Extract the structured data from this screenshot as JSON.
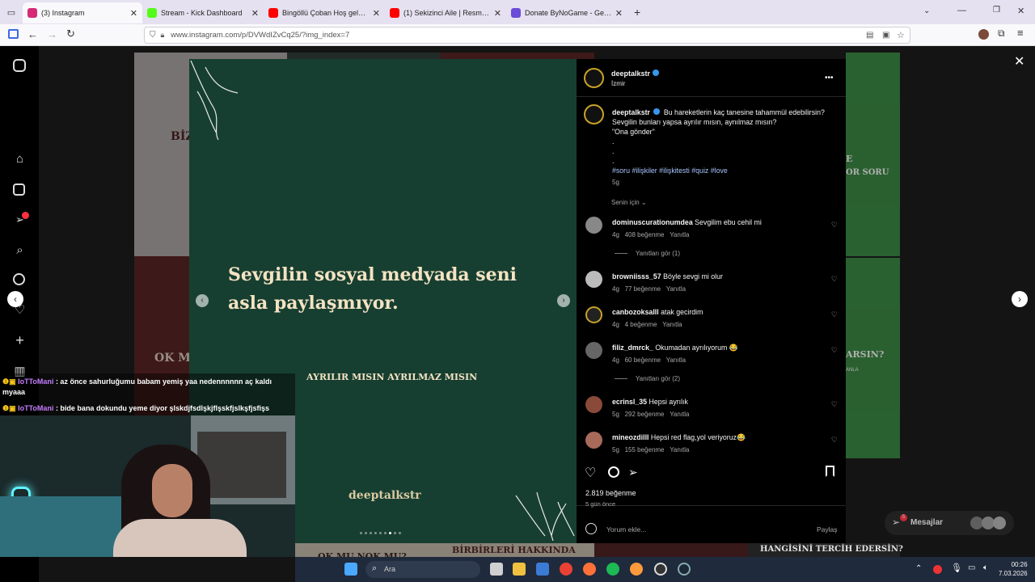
{
  "tabs": [
    {
      "title": "(3) Instagram",
      "color": "#d62976"
    },
    {
      "title": "Stream - Kick Dashboard",
      "color": "#53fc18"
    },
    {
      "title": "Bingöllü Çoban Hoş geldiniz - Y",
      "color": "#ff0000"
    },
    {
      "title": "(1) Sekizinci Aile | Resmi Fragm",
      "color": "#ff0000"
    },
    {
      "title": "Donate ByNoGame - Gelen/Gid",
      "color": "#6b4bd8"
    }
  ],
  "url": "www.instagram.com/p/DVWdIZvCq25/?img_index=7",
  "post": {
    "author": "deeptalkstr",
    "location": "İzmir",
    "caption": "Bu hareketlerin kaç tanesine tahammül edebilirsin? Sevgilin bunları yapsa ayrılır mısın, aynılmaz mısın?",
    "caption_line3": "\"Ona gönder\"",
    "dot": ".",
    "hashtags": "#soru #ilişkiler #ilişkitesti #quiz #love",
    "caption_time": "5g",
    "sort_label": "Senin için",
    "likes": "2.819 beğenme",
    "time_ago": "5 gün önce",
    "comment_placeholder": "Yorum ekle...",
    "share_label": "Paylaş",
    "more_icon": "•••"
  },
  "slide": {
    "headline_1": "Sevgilin sosyal medyada seni",
    "headline_2": "asla paylaşmıyor.",
    "question": "AYRILIR MISIN AYRILMAZ MISIN",
    "brand": "deeptalkstr",
    "active_dot": 6,
    "dots": 9
  },
  "comments": [
    {
      "user": "dominuscurationumdea",
      "text": "Sevgilim ebu cehil mi",
      "time": "4g",
      "likes": "408 beğenme",
      "reply": "Yanıtla",
      "replies": "Yanıtları gör (1)"
    },
    {
      "user": "browniisss_57",
      "text": "Böyle sevgi mi olur",
      "time": "4g",
      "likes": "77 beğenme",
      "reply": "Yanıtla",
      "replies": ""
    },
    {
      "user": "canbozoksalll",
      "text": "atak gecirdim",
      "time": "4g",
      "likes": "4 beğenme",
      "reply": "Yanıtla",
      "replies": ""
    },
    {
      "user": "filiz_dmrck_",
      "text": "Okumadan ayrılıyorum 😂",
      "time": "4g",
      "likes": "60 beğenme",
      "reply": "Yanıtla",
      "replies": "Yanıtları gör (2)"
    },
    {
      "user": "ecrinsl_35",
      "text": "Hepsi ayrılık",
      "time": "5g",
      "likes": "292 beğenme",
      "reply": "Yanıtla",
      "replies": ""
    },
    {
      "user": "mineozdilll",
      "text": "Hepsi red flag,yol veriyoruz😂",
      "time": "5g",
      "likes": "155 beğenme",
      "reply": "Yanıtla",
      "replies": ""
    }
  ],
  "background": {
    "left_1": "BİZ",
    "left_2": "OK M",
    "right_1": "E",
    "right_2": "OR SORU",
    "right_3": "ARSIN?",
    "right_4": "ANLA",
    "bottom_1": "OK MU NOK MU?",
    "bottom_2": "BİRBİRLERİ HAKKINDA",
    "bottom_3": "HANGİSİNİ TERCİH EDERSİN?",
    "messages": "Mesajlar",
    "messages_badge": "5"
  },
  "chat": [
    {
      "user": "IoTToMani",
      "text": ": az önce sahurluğumu babam yemiş yaa nedennnnnn aç kaldı myaaa"
    },
    {
      "user": "IoTToMani",
      "text": ": bide bana dokundu yeme diyor şlskdjfsdlşkjflşskfjslkşfjsfişs"
    }
  ],
  "taskbar": {
    "search": "Ara",
    "time": "00:26",
    "date": "7.03.2026"
  }
}
